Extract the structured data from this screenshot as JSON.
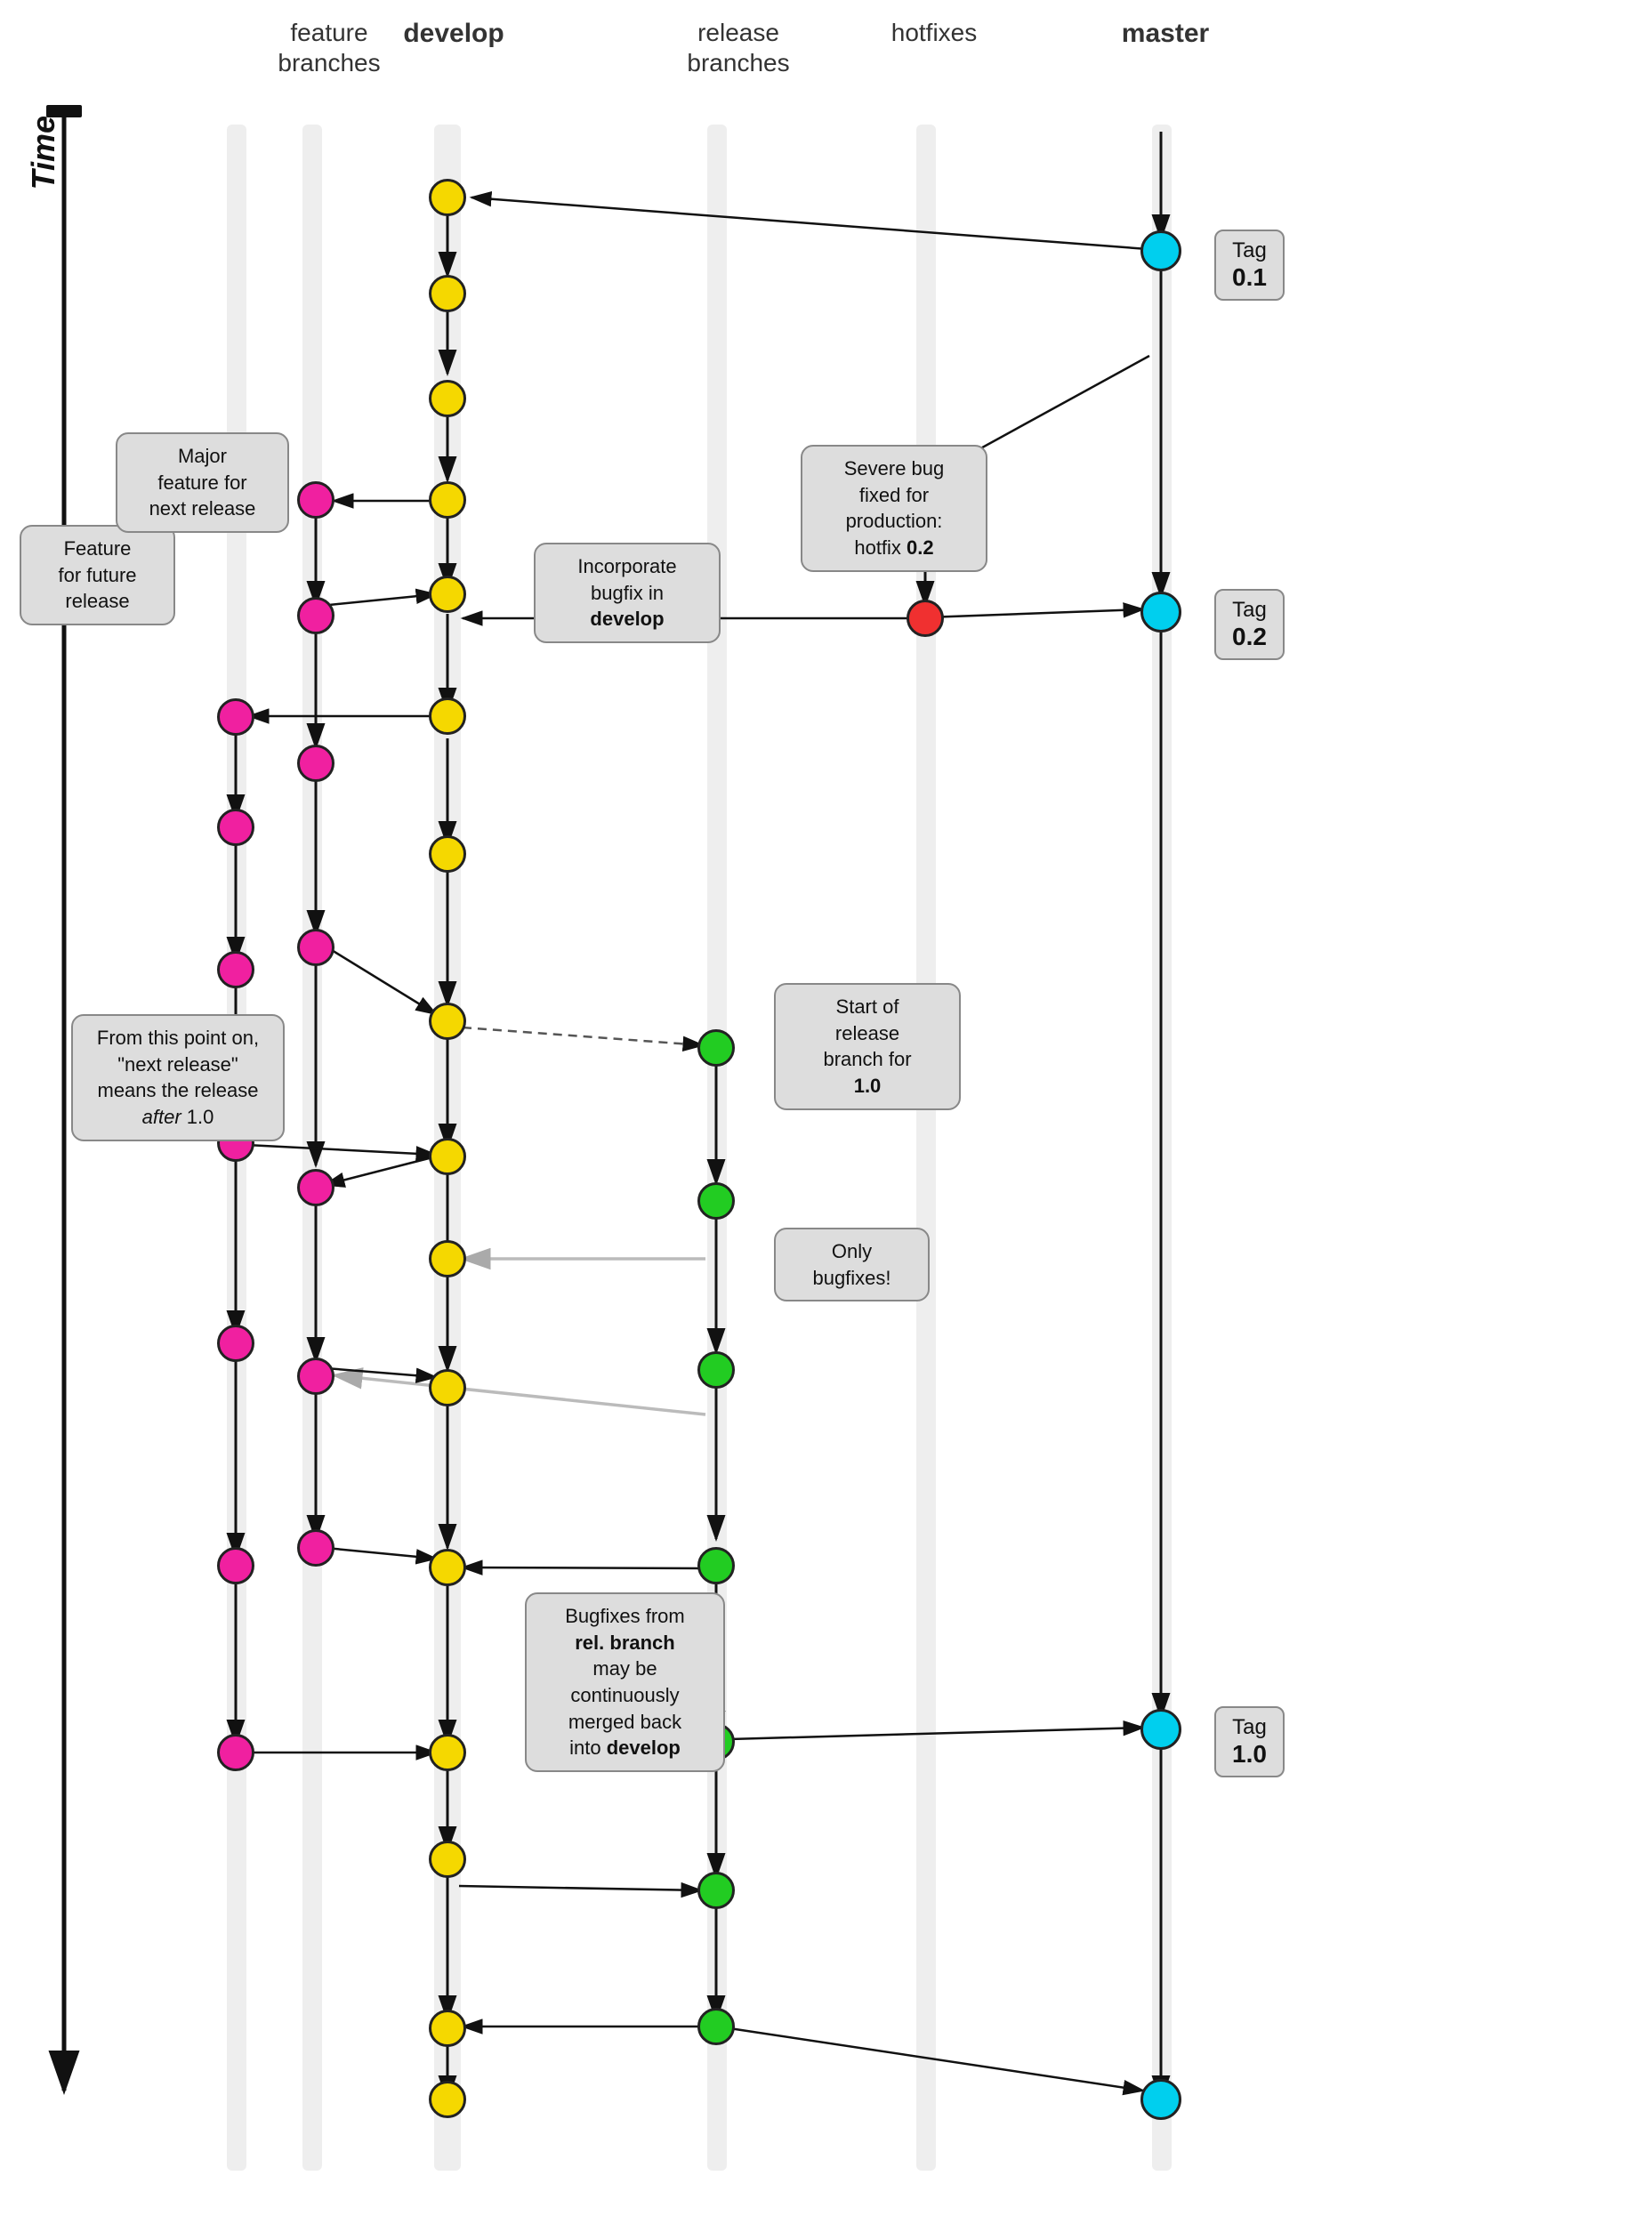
{
  "headers": {
    "feature_branches": "feature\nbranches",
    "develop": "develop",
    "release_branches": "release\nbranches",
    "hotfixes": "hotfixes",
    "master": "master"
  },
  "time_label": "Time",
  "callouts": {
    "feature_future": "Feature\nfor future\nrelease",
    "major_feature": "Major\nfeature for\nnext release",
    "severe_bug": "Severe bug\nfixed for\nproduction:\nhotfix 0.2",
    "incorporate_bugfix": "Incorporate\nbugfix in\ndevelop",
    "start_release": "Start of\nrelease\nbranch for\n1.0",
    "next_release": "From this point on,\n\"next release\"\nmeans the release\nafter 1.0",
    "only_bugfixes": "Only\nbugfixes!",
    "bugfixes_from_rel": "Bugfixes from\nrel. branch\nmay be\ncontinuously\nmerged back\ninto develop"
  },
  "tags": {
    "tag_01": {
      "label": "Tag",
      "value": "0.1"
    },
    "tag_02": {
      "label": "Tag",
      "value": "0.2"
    },
    "tag_10": {
      "label": "Tag",
      "value": "1.0"
    }
  }
}
